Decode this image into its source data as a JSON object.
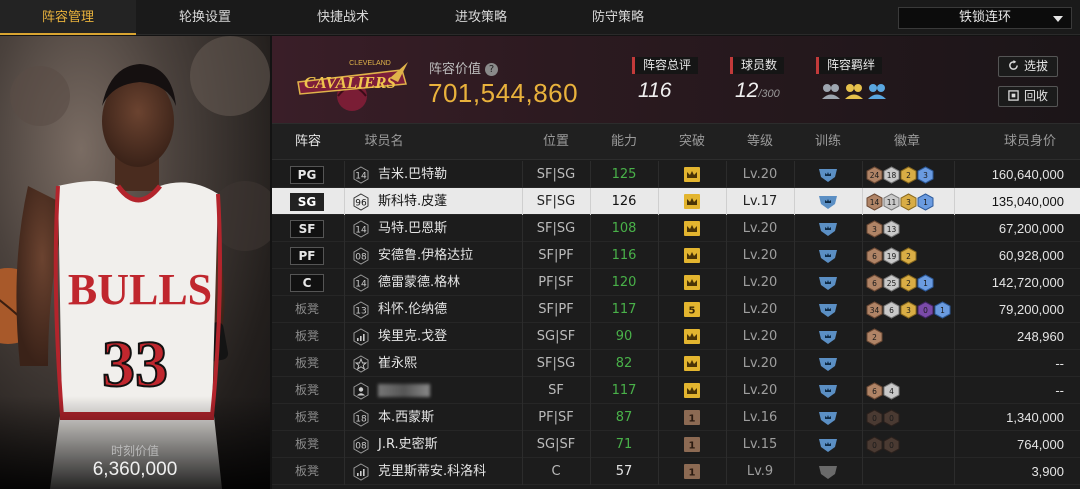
{
  "nav": {
    "tabs": [
      "阵容管理",
      "轮换设置",
      "快捷战术",
      "进攻策略",
      "防守策略"
    ],
    "active_tab": "阵容管理",
    "dropdown_value": "铁锁连环"
  },
  "player_panel": {
    "jersey_text": "BULLS",
    "jersey_number": "33",
    "value_label": "时刻价值",
    "value": "6,360,000"
  },
  "team": {
    "logo_text": "CAVALIERS",
    "logo_subtext": "CLEVELAND",
    "value_label": "阵容价值",
    "value": "701,544,860",
    "stats": [
      {
        "label": "阵容总评",
        "value": "116",
        "suffix": ""
      },
      {
        "label": "球员数",
        "value": "12",
        "suffix": "/300"
      },
      {
        "label": "阵容羁绊",
        "value": "",
        "suffix": ""
      }
    ],
    "buttons": [
      {
        "label": "选拔",
        "icon": "refresh-icon"
      },
      {
        "label": "回收",
        "icon": "recycle-icon"
      }
    ]
  },
  "table": {
    "headers": [
      "阵容",
      "球员名",
      "位置",
      "能力",
      "突破",
      "等级",
      "训练",
      "徽章",
      "球员身价"
    ],
    "rows": [
      {
        "slot": "PG",
        "starter": true,
        "num": "14",
        "numtype": "num",
        "name": "吉米.巴特勒",
        "pos": "SF|SG",
        "ability": "125",
        "abgreen": true,
        "bp": "crown",
        "bpnum": "",
        "level": "Lv.20",
        "train": "blue",
        "badges": [
          [
            "24",
            "bronze"
          ],
          [
            "18",
            "silver"
          ],
          [
            "2",
            "gold"
          ],
          [
            "3",
            "blue"
          ]
        ],
        "price": "160,640,000",
        "selected": false
      },
      {
        "slot": "SG",
        "starter": true,
        "num": "96",
        "numtype": "num",
        "name": "斯科特.皮蓬",
        "pos": "SF|SG",
        "ability": "126",
        "abgreen": true,
        "bp": "crown",
        "bpnum": "",
        "level": "Lv.17",
        "train": "blue",
        "badges": [
          [
            "14",
            "bronze"
          ],
          [
            "11",
            "silver"
          ],
          [
            "3",
            "gold"
          ],
          [
            "1",
            "blue"
          ]
        ],
        "price": "135,040,000",
        "selected": true
      },
      {
        "slot": "SF",
        "starter": true,
        "num": "14",
        "numtype": "num",
        "name": "马特.巴恩斯",
        "pos": "SF|SG",
        "ability": "108",
        "abgreen": true,
        "bp": "crown",
        "bpnum": "",
        "level": "Lv.20",
        "train": "blue",
        "badges": [
          [
            "3",
            "bronze"
          ],
          [
            "13",
            "silver"
          ]
        ],
        "price": "67,200,000",
        "selected": false
      },
      {
        "slot": "PF",
        "starter": true,
        "num": "08",
        "numtype": "num",
        "name": "安德鲁.伊格达拉",
        "pos": "SF|PF",
        "ability": "116",
        "abgreen": true,
        "bp": "crown",
        "bpnum": "",
        "level": "Lv.20",
        "train": "blue",
        "badges": [
          [
            "6",
            "bronze"
          ],
          [
            "19",
            "silver"
          ],
          [
            "2",
            "gold"
          ]
        ],
        "price": "60,928,000",
        "selected": false
      },
      {
        "slot": "C",
        "starter": true,
        "num": "14",
        "numtype": "num",
        "name": "德雷蒙德.格林",
        "pos": "PF|SF",
        "ability": "120",
        "abgreen": true,
        "bp": "crown",
        "bpnum": "",
        "level": "Lv.20",
        "train": "blue",
        "badges": [
          [
            "6",
            "bronze"
          ],
          [
            "25",
            "silver"
          ],
          [
            "2",
            "gold"
          ],
          [
            "1",
            "blue"
          ]
        ],
        "price": "142,720,000",
        "selected": false
      },
      {
        "slot": "板凳",
        "starter": false,
        "num": "13",
        "numtype": "num",
        "name": "科怀.伦纳德",
        "pos": "SF|PF",
        "ability": "117",
        "abgreen": true,
        "bp": "gold",
        "bpnum": "5",
        "level": "Lv.20",
        "train": "blue",
        "badges": [
          [
            "34",
            "bronze"
          ],
          [
            "6",
            "silver"
          ],
          [
            "3",
            "gold"
          ],
          [
            "0",
            "purple"
          ],
          [
            "1",
            "blue"
          ]
        ],
        "price": "79,200,000",
        "selected": false
      },
      {
        "slot": "板凳",
        "starter": false,
        "num": "",
        "numtype": "bars",
        "name": "埃里克.戈登",
        "pos": "SG|SF",
        "ability": "90",
        "abgreen": true,
        "bp": "crown",
        "bpnum": "",
        "level": "Lv.20",
        "train": "blue",
        "badges": [
          [
            "2",
            "bronze"
          ]
        ],
        "price": "248,960",
        "selected": false
      },
      {
        "slot": "板凳",
        "starter": false,
        "num": "",
        "numtype": "star",
        "name": "崔永熙",
        "pos": "SF|SG",
        "ability": "82",
        "abgreen": true,
        "bp": "crown",
        "bpnum": "",
        "level": "Lv.20",
        "train": "blue",
        "badges": [],
        "price": "--",
        "selected": false
      },
      {
        "slot": "板凳",
        "starter": false,
        "num": "",
        "numtype": "person",
        "name": "",
        "pos": "SF",
        "ability": "117",
        "abgreen": true,
        "bp": "crown",
        "bpnum": "",
        "level": "Lv.20",
        "train": "blue",
        "badges": [
          [
            "6",
            "bronze"
          ],
          [
            "4",
            "silver"
          ]
        ],
        "price": "--",
        "selected": false
      },
      {
        "slot": "板凳",
        "starter": false,
        "num": "18",
        "numtype": "num",
        "name": "本.西蒙斯",
        "pos": "PF|SF",
        "ability": "87",
        "abgreen": true,
        "bp": "brown",
        "bpnum": "1",
        "level": "Lv.16",
        "train": "blue",
        "badges": [
          [
            "0",
            "dark"
          ],
          [
            "0",
            "dark"
          ]
        ],
        "price": "1,340,000",
        "selected": false
      },
      {
        "slot": "板凳",
        "starter": false,
        "num": "08",
        "numtype": "num",
        "name": "J.R.史密斯",
        "pos": "SG|SF",
        "ability": "71",
        "abgreen": true,
        "bp": "brown",
        "bpnum": "1",
        "level": "Lv.15",
        "train": "blue",
        "badges": [
          [
            "0",
            "dark"
          ],
          [
            "0",
            "dark"
          ]
        ],
        "price": "764,000",
        "selected": false
      },
      {
        "slot": "板凳",
        "starter": false,
        "num": "",
        "numtype": "bars",
        "name": "克里斯蒂安.科洛科",
        "pos": "C",
        "ability": "57",
        "abgreen": false,
        "bp": "brown",
        "bpnum": "1",
        "level": "Lv.9",
        "train": "gray",
        "badges": [],
        "price": "3,900",
        "selected": false
      }
    ]
  },
  "colors": {
    "accent_gold": "#e9b23c",
    "ability_green": "#49b149",
    "train_blue": "#5b8fc4",
    "badge_bronze": "#a97a5a",
    "badge_silver": "#bfbfbf",
    "badge_gold": "#d4a93b",
    "badge_blue": "#5d8fd6",
    "badge_purple": "#7a4aa8"
  }
}
